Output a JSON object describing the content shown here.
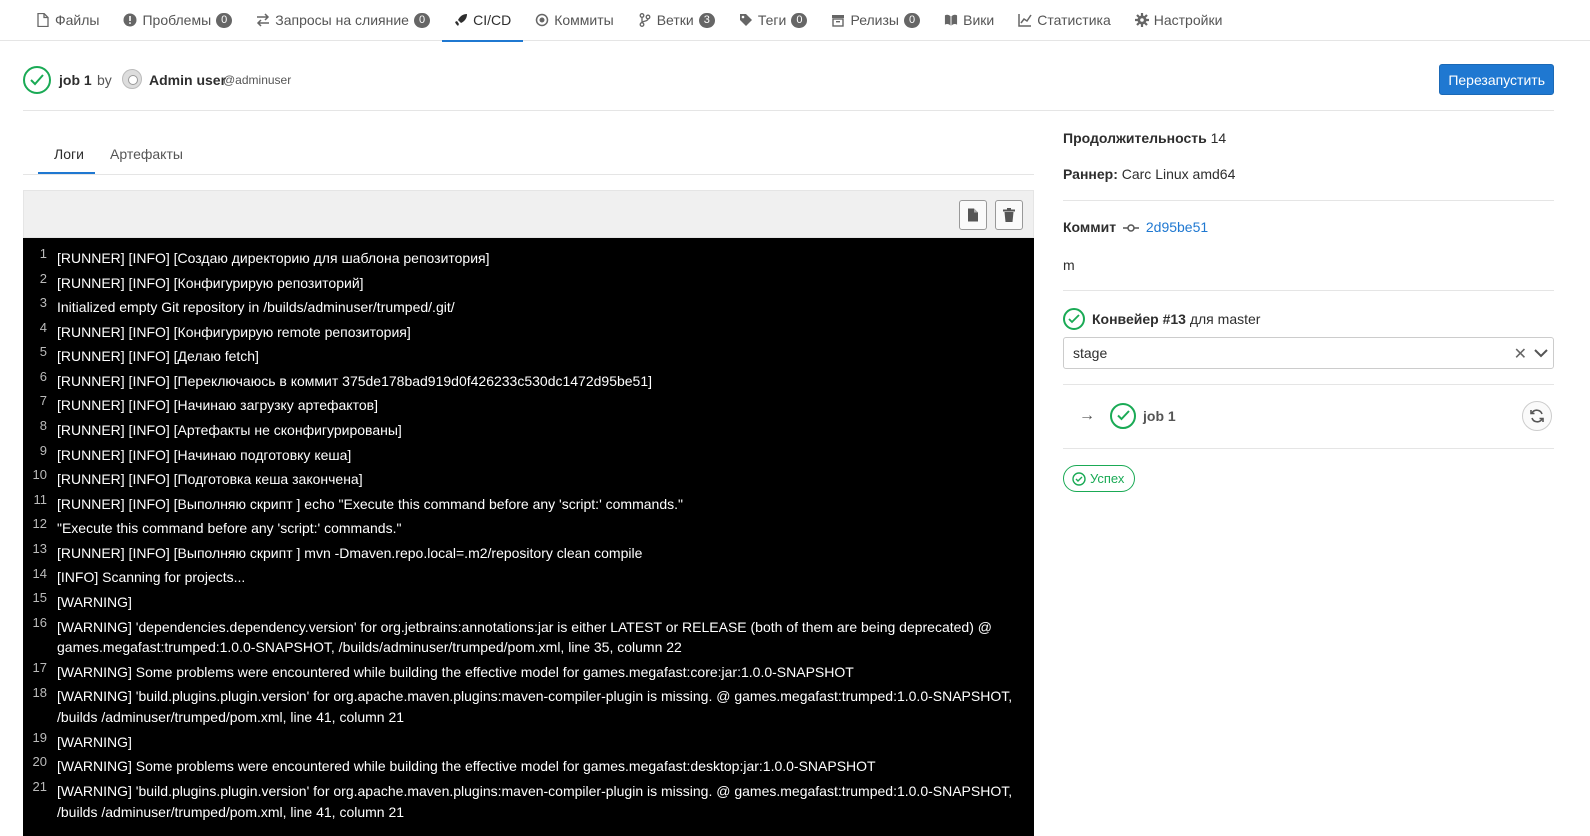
{
  "nav": {
    "files": "Файлы",
    "issues": "Проблемы",
    "issues_count": "0",
    "merge_requests": "Запросы на слияние",
    "merge_requests_count": "0",
    "cicd": "CI/CD",
    "commits": "Коммиты",
    "branches": "Ветки",
    "branches_count": "3",
    "tags": "Теги",
    "tags_count": "0",
    "releases": "Релизы",
    "releases_count": "0",
    "wiki": "Вики",
    "stats": "Статистика",
    "settings": "Настройки"
  },
  "header": {
    "job_name": "job 1",
    "by": "by",
    "author": "Admin user",
    "handle": "@adminuser",
    "retry_label": "Перезапустить"
  },
  "tabs": {
    "logs": "Логи",
    "artifacts": "Артефакты"
  },
  "log_lines": [
    {
      "n": "1",
      "t": "[RUNNER] [INFO] [Создаю директорию для шаблона репозитория]"
    },
    {
      "n": "2",
      "t": "[RUNNER] [INFO] [Конфигурирую репозиторий]"
    },
    {
      "n": "3",
      "t": "Initialized empty Git repository in /builds/adminuser/trumped/.git/"
    },
    {
      "n": "4",
      "t": "[RUNNER] [INFO] [Конфигурирую remote репозитория]"
    },
    {
      "n": "5",
      "t": "[RUNNER] [INFO] [Делаю fetch]"
    },
    {
      "n": "6",
      "t": "[RUNNER] [INFO] [Переключаюсь в коммит 375de178bad919d0f426233c530dc1472d95be51]"
    },
    {
      "n": "7",
      "t": "[RUNNER] [INFO] [Начинаю загрузку артефактов]"
    },
    {
      "n": "8",
      "t": "[RUNNER] [INFO] [Артефакты не сконфигурированы]"
    },
    {
      "n": "9",
      "t": "[RUNNER] [INFO] [Начинаю подготовку кеша]"
    },
    {
      "n": "10",
      "t": "[RUNNER] [INFO] [Подготовка кеша закончена]"
    },
    {
      "n": "11",
      "t": "[RUNNER] [INFO] [Выполняю скрипт ] echo \"Execute this command before any 'script:' commands.\""
    },
    {
      "n": "12",
      "t": "\"Execute this command before any 'script:' commands.\""
    },
    {
      "n": "13",
      "t": "[RUNNER] [INFO] [Выполняю скрипт ] mvn -Dmaven.repo.local=.m2/repository clean compile"
    },
    {
      "n": "14",
      "t": "[INFO] Scanning for projects..."
    },
    {
      "n": "15",
      "t": "[WARNING]"
    },
    {
      "n": "16",
      "t": "[WARNING] 'dependencies.dependency.version' for org.jetbrains:annotations:jar is either LATEST or RELEASE (both of them are being deprecated) @ games.megafast:trumped:1.0.0-SNAPSHOT, /builds/adminuser/trumped/pom.xml, line 35, column 22"
    },
    {
      "n": "17",
      "t": "[WARNING] Some problems were encountered while building the effective model for games.megafast:core:jar:1.0.0-SNAPSHOT"
    },
    {
      "n": "18",
      "t": "[WARNING] 'build.plugins.plugin.version' for org.apache.maven.plugins:maven-compiler-plugin is missing. @ games.megafast:trumped:1.0.0-SNAPSHOT, /builds /adminuser/trumped/pom.xml, line 41, column 21"
    },
    {
      "n": "19",
      "t": "[WARNING]"
    },
    {
      "n": "20",
      "t": "[WARNING] Some problems were encountered while building the effective model for games.megafast:desktop:jar:1.0.0-SNAPSHOT"
    },
    {
      "n": "21",
      "t": "[WARNING] 'build.plugins.plugin.version' for org.apache.maven.plugins:maven-compiler-plugin is missing. @ games.megafast:trumped:1.0.0-SNAPSHOT, /builds /adminuser/trumped/pom.xml, line 41, column 21"
    }
  ],
  "sidebar": {
    "duration_label": "Продолжительность",
    "duration_value": "14",
    "runner_label": "Раннер:",
    "runner_value": "Carc Linux amd64",
    "commit_label": "Коммит",
    "commit_sha": "2d95be51",
    "commit_message": "m",
    "pipeline_label": "Конвейер #13",
    "pipeline_for": "для master",
    "stage_value": "stage",
    "job_name": "job 1",
    "status": "Успех"
  },
  "colors": {
    "accent": "#1f78d1",
    "success": "#1aaa55",
    "log_bg": "#000000"
  }
}
